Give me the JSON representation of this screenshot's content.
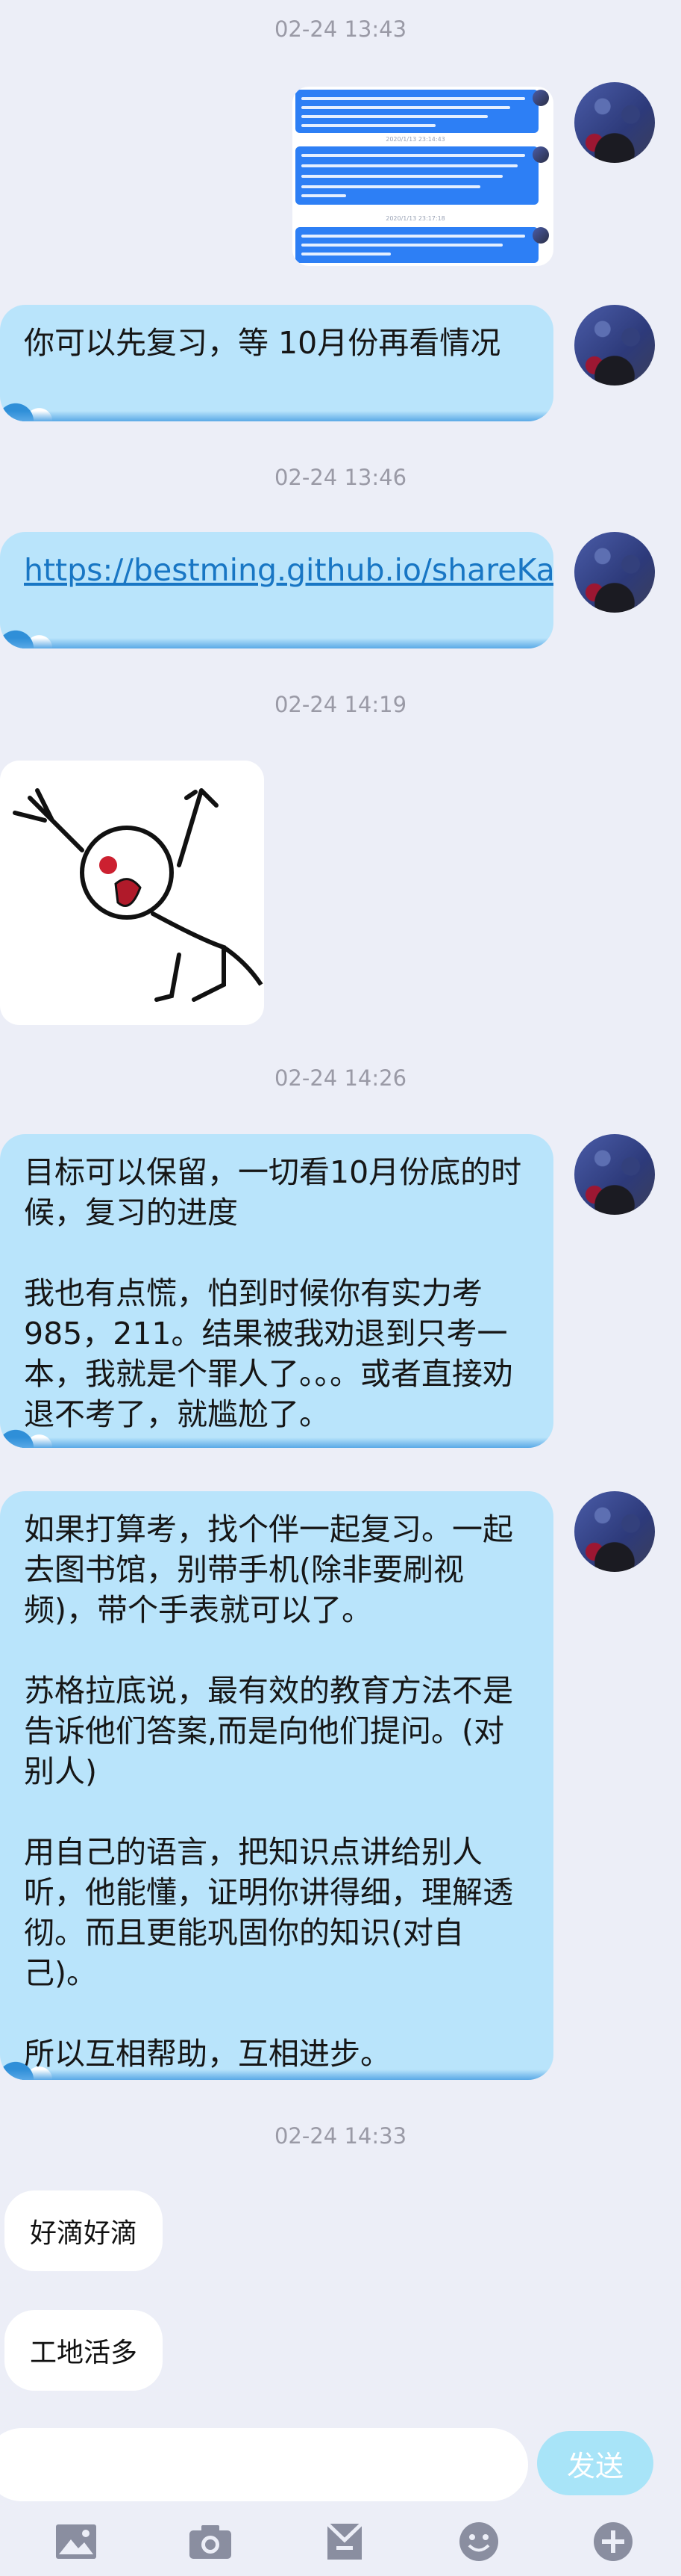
{
  "timestamps": [
    "02-24 13:43",
    "02-24 13:46",
    "02-24 14:19",
    "02-24 14:26",
    "02-24 14:33"
  ],
  "screenshot_card": {
    "times": [
      "2020/1/13 23:14:43",
      "2020/1/13 23:17:18"
    ]
  },
  "messages": {
    "m1": "你可以先复习，等 10月份再看情况",
    "link": "https://bestming.github.io/shareKaoYan/",
    "m3_paragraphs": [
      "目标可以保留，一切看10月份底的时候，复习的进度",
      "我也有点慌，怕到时候你有实力考985，211。结果被我劝退到只考一本，我就是个罪人了。。。或者直接劝退不考了，就尴尬了。"
    ],
    "m4_paragraphs": [
      "如果打算考，找个伴一起复习。一起去图书馆，别带手机(除非要刷视频)，带个手表就可以了。",
      "苏格拉底说，最有效的教育方法不是告诉他们答案,而是向他们提问。(对别人)",
      "用自己的语言，把知识点讲给别人听，他能懂，证明你讲得细，理解透彻。而且更能巩固你的知识(对自己)。",
      "所以互相帮助，互相进步。"
    ],
    "reply1": "好滴好滴",
    "reply2": "工地活多"
  },
  "input": {
    "placeholder": "",
    "send_label": "发送"
  },
  "toolbar": {
    "icons": [
      "image-icon",
      "camera-icon",
      "folder-icon",
      "emoji-icon",
      "plus-icon"
    ]
  }
}
